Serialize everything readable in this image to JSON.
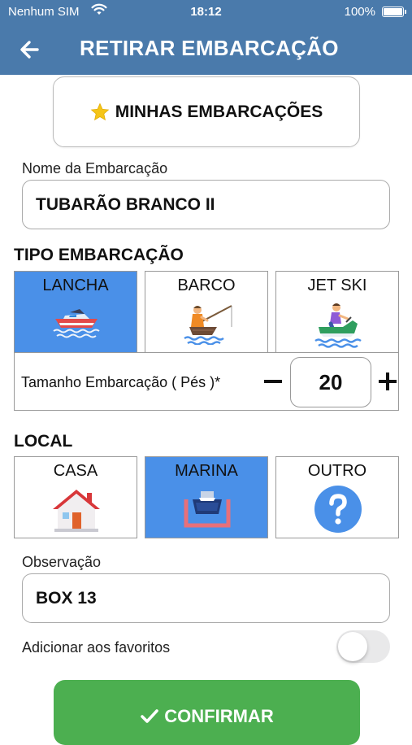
{
  "status_bar": {
    "carrier": "Nenhum SIM",
    "time": "18:12",
    "battery": "100%"
  },
  "header": {
    "title": "RETIRAR EMBARCAÇÃO",
    "back_icon": "arrow-left-icon"
  },
  "favorites_button": {
    "label": "MINHAS EMBARCAÇÕES",
    "icon": "star-icon"
  },
  "boat_name": {
    "label": "Nome da Embarcação",
    "value": "TUBARÃO BRANCO II"
  },
  "boat_type": {
    "title": "TIPO EMBARCAÇÃO",
    "options": [
      {
        "label": "LANCHA",
        "icon": "speedboat-icon",
        "selected": true
      },
      {
        "label": "BARCO",
        "icon": "fishing-boat-icon",
        "selected": false
      },
      {
        "label": "JET SKI",
        "icon": "jet-ski-icon",
        "selected": false
      }
    ]
  },
  "boat_size": {
    "label": "Tamanho Embarcação ( Pés )*",
    "value": "20"
  },
  "location": {
    "title": "LOCAL",
    "options": [
      {
        "label": "CASA",
        "icon": "house-icon",
        "selected": false
      },
      {
        "label": "MARINA",
        "icon": "marina-icon",
        "selected": true
      },
      {
        "label": "OUTRO",
        "icon": "question-icon",
        "selected": false
      }
    ]
  },
  "observation": {
    "label": "Observação",
    "value": "BOX 13"
  },
  "favorite_toggle": {
    "label": "Adicionar aos favoritos",
    "on": false
  },
  "confirm_button": {
    "label": "CONFIRMAR",
    "icon": "check-icon"
  },
  "colors": {
    "header": "#4a7aab",
    "selected": "#4a90e8",
    "confirm": "#4caf50"
  }
}
